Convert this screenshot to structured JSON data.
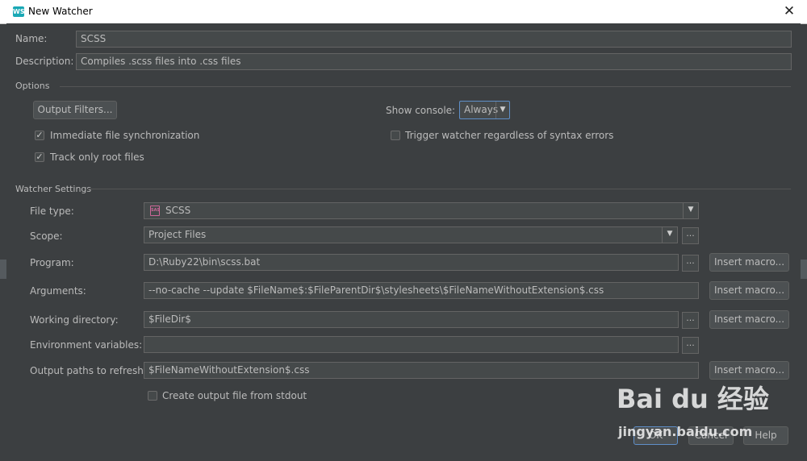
{
  "window": {
    "title": "New Watcher",
    "app_icon": "WS"
  },
  "name": {
    "label": "Name:",
    "value": "SCSS"
  },
  "description": {
    "label": "Description:",
    "value": "Compiles .scss files into .css files"
  },
  "options": {
    "section_title": "Options",
    "output_filters_label": "Output Filters...",
    "show_console_label": "Show console:",
    "show_console_value": "Always",
    "immediate_sync": {
      "label": "Immediate file synchronization",
      "checked": true
    },
    "track_root": {
      "label": "Track only root files",
      "checked": true
    },
    "trigger_regardless": {
      "label": "Trigger watcher regardless of syntax errors",
      "checked": false
    }
  },
  "settings": {
    "section_title": "Watcher Settings",
    "file_type": {
      "label": "File type:",
      "value": "SCSS",
      "icon_text": "SASS"
    },
    "scope": {
      "label": "Scope:",
      "value": "Project Files"
    },
    "program": {
      "label": "Program:",
      "value": "D:\\Ruby22\\bin\\scss.bat"
    },
    "arguments": {
      "label": "Arguments:",
      "value": "--no-cache --update $FileName$:$FileParentDir$\\stylesheets\\$FileNameWithoutExtension$.css"
    },
    "working_dir": {
      "label": "Working directory:",
      "value": "$FileDir$"
    },
    "env_vars": {
      "label": "Environment variables:",
      "value": ""
    },
    "output_paths": {
      "label": "Output paths to refresh:",
      "value": "$FileNameWithoutExtension$.css"
    },
    "create_output": {
      "label": "Create output file from stdout",
      "checked": false
    },
    "ellipsis": "...",
    "insert_macro_label": "Insert macro..."
  },
  "footer": {
    "ok_label": "OK",
    "cancel_label": "Cancel",
    "help_label": "Help"
  },
  "watermark": {
    "logo": "Bai du 经验",
    "url": "jingyan.baidu.com"
  },
  "colors": {
    "background": "#3c3f41",
    "field": "#45494a",
    "text": "#bbbbbb",
    "focus_border": "#5f8fc8"
  }
}
